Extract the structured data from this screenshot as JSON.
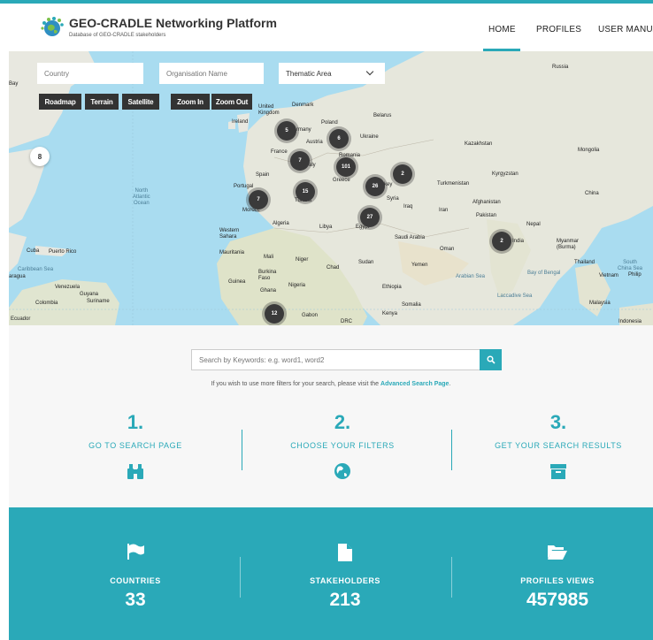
{
  "header": {
    "title": "GEO-CRADLE Networking Platform",
    "subtitle": "Database of GEO-CRADLE stakeholders",
    "nav": [
      {
        "label": "HOME",
        "active": true
      },
      {
        "label": "PROFILES"
      },
      {
        "label": "USER MANUAL"
      }
    ],
    "accent_color": "#2aa9b8"
  },
  "map": {
    "filters": {
      "country_placeholder": "Country",
      "organisation_placeholder": "Organisation Name",
      "thematic_area_selected": "Thematic Area"
    },
    "buttons": {
      "roadmap": "Roadmap",
      "terrain": "Terrain",
      "satellite": "Satellite",
      "zoom_in": "Zoom In",
      "zoom_out": "Zoom Out"
    },
    "pin_label": "8",
    "clusters": [
      "5",
      "6",
      "7",
      "101",
      "2",
      "15",
      "7",
      "26",
      "27",
      "2",
      "12"
    ],
    "labels": {
      "russia": "Russia",
      "denmark": "Denmark",
      "belarus": "Belarus",
      "united_kingdom": "United\nKingdom",
      "ireland": "Ireland",
      "poland": "Poland",
      "germany": "rmany",
      "austria": "Austria",
      "ukraine": "Ukraine",
      "france": "France",
      "romania": "Romania",
      "kazakhstan": "Kazakhstan",
      "mongolia": "Mongolia",
      "italy": "aly",
      "spain": "Spain",
      "greece": "Greece",
      "turkey": "key",
      "turkmenistan": "Turkmenistan",
      "kyrgyzstan": "Kyrgyzstan",
      "portugal": "Portugal",
      "tunisia": "Tunisia",
      "syria": "Syria",
      "afghanistan": "Afghanistan",
      "iran": "Iran",
      "iraq": "Iraq",
      "china": "China",
      "pakistan": "Pakistan",
      "nepal": "Nepal",
      "morocco": "Morocc",
      "algeria": "Algeria",
      "libya": "Libya",
      "egypt": "Egypt",
      "saudi_arabia": "Saudi Arabia",
      "india": "India",
      "oman": "Oman",
      "myanmar": "Myanmar\n(Burma)",
      "western_sahara": "Western\nSahara",
      "mauritania": "Mauritania",
      "mali": "Mali",
      "niger": "Niger",
      "chad": "Chad",
      "sudan": "Sudan",
      "yemen": "Yemen",
      "thailand": "Thailand",
      "burkina_faso": "Burkina\nFaso",
      "guinea": "Guinea",
      "nigeria": "Nigeria",
      "ethiopia": "Ethiopia",
      "vietnam": "Vietnam",
      "ghana": "Ghana",
      "somalia": "Somalia",
      "kenya": "Kenya",
      "gabon": "Gabon",
      "cuba": "Cuba",
      "puerto_rico": "Puerto Rico",
      "venezuela": "Venezuela",
      "guyana": "Guyana",
      "suriname": "Suriname",
      "colombia": "Colombia",
      "ecuador": "Ecuador",
      "malaysia": "Malaysia",
      "indonesia": "Indonesia",
      "north_atlantic": "North\nAtlantic\nOcean",
      "arabian_sea": "Arabian Sea",
      "bay_of_bengal": "Bay of Bengal",
      "caribbean_sea": "Caribbean Sea",
      "laccadive_sea": "Laccadive Sea",
      "south_china_sea": "South\nChina Sea",
      "philippines": "Philip",
      "nicaragua": "aragua",
      "bay": "Bay",
      "drc": "DRC"
    }
  },
  "search": {
    "placeholder": "Search by Keywords: e.g. word1, word2",
    "hint_prefix": "If you wish to use more filters for your search, please visit the",
    "hint_link": "Advanced Search Page",
    "hint_suffix": "."
  },
  "steps": [
    {
      "number": "1.",
      "label": "GO TO SEARCH PAGE",
      "icon": "binoculars-icon"
    },
    {
      "number": "2.",
      "label": "CHOOSE YOUR FILTERS",
      "icon": "globe-icon"
    },
    {
      "number": "3.",
      "label": "GET YOUR SEARCH RESULTS",
      "icon": "archive-icon"
    }
  ],
  "stats": [
    {
      "label": "COUNTRIES",
      "value": "33",
      "icon": "flag-icon"
    },
    {
      "label": "STAKEHOLDERS",
      "value": "213",
      "icon": "file-icon"
    },
    {
      "label": "PROFILES VIEWS",
      "value": "457985",
      "icon": "folder-open-icon"
    }
  ]
}
